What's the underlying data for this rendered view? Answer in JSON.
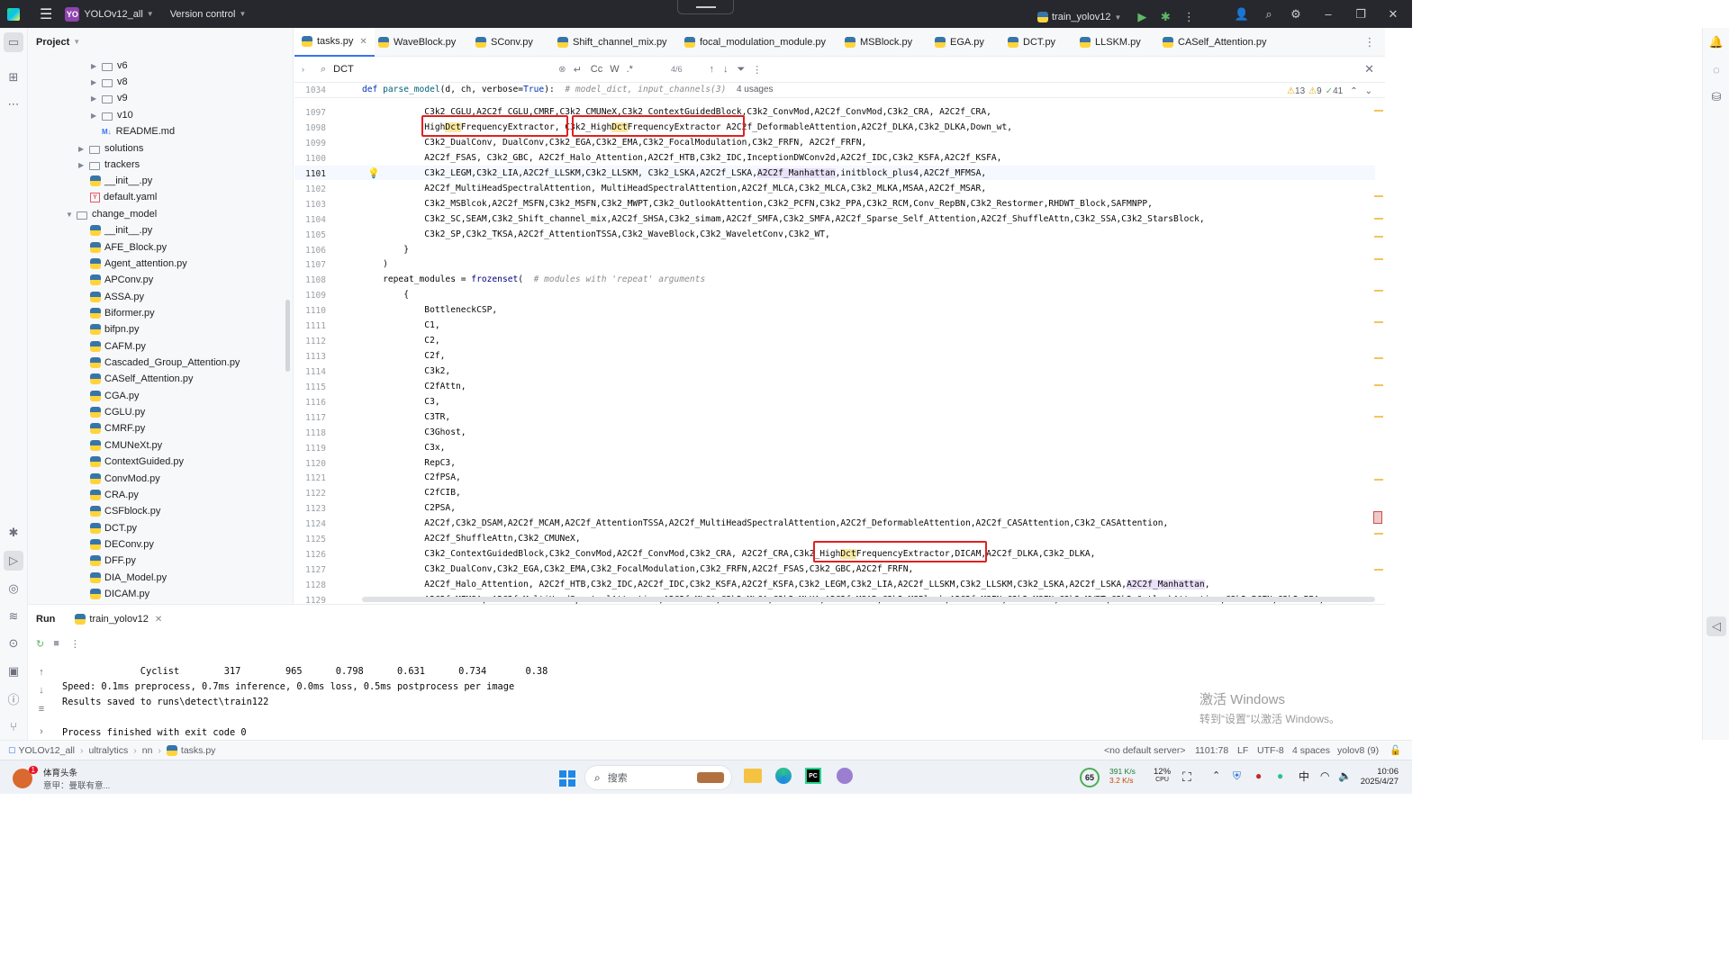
{
  "titlebar": {
    "project_badge": "YO",
    "project_name": "YOLOv12_all",
    "version_control": "Version control",
    "run_config": "train_yolov12"
  },
  "project_panel": {
    "title": "Project",
    "items": [
      {
        "label": "v6",
        "kind": "folder"
      },
      {
        "label": "v8",
        "kind": "folder"
      },
      {
        "label": "v9",
        "kind": "folder"
      },
      {
        "label": "v10",
        "kind": "folder"
      },
      {
        "label": "README.md",
        "kind": "md"
      },
      {
        "label": "solutions",
        "kind": "folder"
      },
      {
        "label": "trackers",
        "kind": "folder"
      },
      {
        "label": "__init__.py",
        "kind": "py"
      },
      {
        "label": "default.yaml",
        "kind": "yaml"
      },
      {
        "label": "change_model",
        "kind": "folder-open"
      },
      {
        "label": "__init__.py",
        "kind": "py"
      },
      {
        "label": "AFE_Block.py",
        "kind": "py"
      },
      {
        "label": "Agent_attention.py",
        "kind": "py"
      },
      {
        "label": "APConv.py",
        "kind": "py"
      },
      {
        "label": "ASSA.py",
        "kind": "py"
      },
      {
        "label": "Biformer.py",
        "kind": "py"
      },
      {
        "label": "bifpn.py",
        "kind": "py"
      },
      {
        "label": "CAFM.py",
        "kind": "py"
      },
      {
        "label": "Cascaded_Group_Attention.py",
        "kind": "py"
      },
      {
        "label": "CASelf_Attention.py",
        "kind": "py"
      },
      {
        "label": "CGA.py",
        "kind": "py"
      },
      {
        "label": "CGLU.py",
        "kind": "py"
      },
      {
        "label": "CMRF.py",
        "kind": "py"
      },
      {
        "label": "CMUNeXt.py",
        "kind": "py"
      },
      {
        "label": "ContextGuided.py",
        "kind": "py"
      },
      {
        "label": "ConvMod.py",
        "kind": "py"
      },
      {
        "label": "CRA.py",
        "kind": "py"
      },
      {
        "label": "CSFblock.py",
        "kind": "py"
      },
      {
        "label": "DCT.py",
        "kind": "py"
      },
      {
        "label": "DEConv.py",
        "kind": "py"
      },
      {
        "label": "DFF.py",
        "kind": "py"
      },
      {
        "label": "DIA_Model.py",
        "kind": "py"
      },
      {
        "label": "DICAM.py",
        "kind": "py"
      }
    ]
  },
  "tabs": [
    {
      "label": "tasks.py",
      "active": true
    },
    {
      "label": "WaveBlock.py"
    },
    {
      "label": "SConv.py"
    },
    {
      "label": "Shift_channel_mix.py"
    },
    {
      "label": "focal_modulation_module.py"
    },
    {
      "label": "MSBlock.py"
    },
    {
      "label": "EGA.py"
    },
    {
      "label": "DCT.py"
    },
    {
      "label": "LLSKM.py"
    },
    {
      "label": "CASelf_Attention.py"
    }
  ],
  "search": {
    "query": "DCT",
    "match_case": "Cc",
    "words": "W",
    "regex": ".*",
    "count": "4/6"
  },
  "editor": {
    "sticky_line_number": "1034",
    "sticky_def": "def",
    "sticky_name": "parse_model",
    "sticky_args": "(d, ch, verbose=",
    "sticky_true": "True",
    "sticky_close": "):",
    "sticky_comment": "# model_dict, input_channels(3)",
    "sticky_usages": "4 usages",
    "warnings": "13",
    "weak_warnings": "9",
    "typos": "41",
    "line_numbers": [
      "1097",
      "1098",
      "1099",
      "1100",
      "1101",
      "1102",
      "1103",
      "1104",
      "1105",
      "1106",
      "1107",
      "1108",
      "1109",
      "1110",
      "1111",
      "1112",
      "1113",
      "1114",
      "1115",
      "1116",
      "1117",
      "1118",
      "1119",
      "1120",
      "1121",
      "1122",
      "1123",
      "1124",
      "1125",
      "1126",
      "1127",
      "1128",
      "1129"
    ],
    "lines": {
      "l1097": "            C3k2_CGLU,A2C2f_CGLU,CMRF,C3k2_CMUNeX,C3k2_ContextGuidedBlock,C3k2_ConvMod,A2C2f_ConvMod,C3k2_CRA, A2C2f_CRA,",
      "l1098_a": "            High",
      "l1098_b": "Dct",
      "l1098_c": "FrequencyExtractor, C3k2_High",
      "l1098_d": "Dct",
      "l1098_e": "FrequencyExtractor A2C2f_DeformableAttention,A2C2f_DLKA,C3k2_DLKA,Down_wt,",
      "l1099": "            C3k2_DualConv, DualConv,C3k2_EGA,C3k2_EMA,C3k2_FocalModulation,C3k2_FRFN, A2C2f_FRFN,",
      "l1100": "            A2C2f_FSAS, C3k2_GBC, A2C2f_Halo_Attention,A2C2f_HTB,C3k2_IDC,InceptionDWConv2d,A2C2f_IDC,C3k2_KSFA,A2C2f_KSFA,",
      "l1101_a": "            C3k2_LEGM,C3k2_LIA,A2C2f_LLSKM,C3k2_LLSKM, C3k2_LSKA,A2C2f_LSKA,",
      "l1101_b": "A2C2f_Manhattan",
      "l1101_c": ",initblock_plus4,A2C2f_MFMSA,",
      "l1102": "            A2C2f_MultiHeadSpectralAttention, MultiHeadSpectralAttention,A2C2f_MLCA,C3k2_MLCA,C3k2_MLKA,MSAA,A2C2f_MSAR,",
      "l1103": "            C3k2_MSBlcok,A2C2f_MSFN,C3k2_MSFN,C3k2_MWPT,C3k2_OutlookAttention,C3k2_PCFN,C3k2_PPA,C3k2_RCM,Conv_RepBN,C3k2_Restormer,RHDWT_Block,SAFMNPP,",
      "l1104": "            C3k2_SC,SEAM,C3k2_Shift_channel_mix,A2C2f_SHSA,C3k2_simam,A2C2f_SMFA,C3k2_SMFA,A2C2f_Sparse_Self_Attention,A2C2f_ShuffleAttn,C3k2_SSA,C3k2_StarsBlock,",
      "l1105": "            C3k2_SP,C3k2_TKSA,A2C2f_AttentionTSSA,C3k2_WaveBlock,C3k2_WaveletConv,C3k2_WT,",
      "l1106": "        }",
      "l1107": "    )",
      "l1108_a": "    repeat_modules = ",
      "l1108_b": "frozenset",
      "l1108_c": "(  ",
      "l1108_d": "# modules with 'repeat' arguments",
      "l1109": "        {",
      "l1110": "            BottleneckCSP,",
      "l1111": "            C1,",
      "l1112": "            C2,",
      "l1113": "            C2f,",
      "l1114": "            C3k2,",
      "l1115": "            C2fAttn,",
      "l1116": "            C3,",
      "l1117": "            C3TR,",
      "l1118": "            C3Ghost,",
      "l1119": "            C3x,",
      "l1120": "            RepC3,",
      "l1121": "            C2fPSA,",
      "l1122": "            C2fCIB,",
      "l1123": "            C2PSA,",
      "l1124": "            A2C2f,C3k2_DSAM,A2C2f_MCAM,A2C2f_AttentionTSSA,A2C2f_MultiHeadSpectralAttention,A2C2f_DeformableAttention,A2C2f_CASAttention,C3k2_CASAttention,",
      "l1125": "            A2C2f_ShuffleAttn,C3k2_CMUNeX,",
      "l1126_a": "            C3k2_ContextGuidedBlock,C3k2_ConvMod,A2C2f_ConvMod,C3k2_CRA, A2C2f_CRA,C3k2_High",
      "l1126_b": "Dct",
      "l1126_c": "FrequencyExtractor,DICAM,A2C2f_DLKA,C3k2_DLKA,",
      "l1127": "            C3k2_DualConv,C3k2_EGA,C3k2_EMA,C3k2_FocalModulation,C3k2_FRFN,A2C2f_FSAS,C3k2_GBC,A2C2f_FRFN,",
      "l1128_a": "            A2C2f_Halo_Attention, A2C2f_HTB,C3k2_IDC,A2C2f_IDC,C3k2_KSFA,A2C2f_KSFA,C3k2_LEGM,C3k2_LIA,A2C2f_LLSKM,C3k2_LLSKM,C3k2_LSKA,A2C2f_LSKA,",
      "l1128_b": "A2C2f_Manhattan",
      "l1128_c": ",",
      "l1129": "            A2C2f_MFMSA, A2C2f_MultiHeadSpectralAttention,A2C2f_MLCA,C3k2_MLCA,C3k2_MLKA,A2C2f_MSAR,C3k2_MSBlcok,A2C2f_MSFN,C3k2_MSFN,C3k2_MWPT,C3k2_OutlookAttention,C3k2_PCFN,C3k2_PPA,"
    }
  },
  "run_panel": {
    "title": "Run",
    "tab": "train_yolov12",
    "lines": [
      "              Cyclist        317        965      0.798      0.631      0.734       0.38",
      "Speed: 0.1ms preprocess, 0.7ms inference, 0.0ms loss, 0.5ms postprocess per image",
      "Results saved to runs\\detect\\train122",
      "",
      "Process finished with exit code 0"
    ]
  },
  "watermark": {
    "line1": "激活 Windows",
    "line2": "转到“设置”以激活 Windows。"
  },
  "statusbar": {
    "crumb1": "YOLOv12_all",
    "crumb2": "ultralytics",
    "crumb3": "nn",
    "crumb4": "tasks.py",
    "server": "<no default server>",
    "position": "1101:78",
    "line_sep": "LF",
    "encoding": "UTF-8",
    "indent": "4 spaces",
    "interpreter": "yolov8 (9)"
  },
  "taskbar": {
    "news_title": "体育头条",
    "news_sub": "意甲：曼联有意...",
    "news_badge": "1",
    "search_placeholder": "搜索",
    "battery": "65",
    "net_up": "391 K/s",
    "net_down": "3.2 K/s",
    "cpu": "12%",
    "cpu_label": "CPU",
    "ime": "中",
    "time": "10:06",
    "date": "2025/4/27"
  }
}
